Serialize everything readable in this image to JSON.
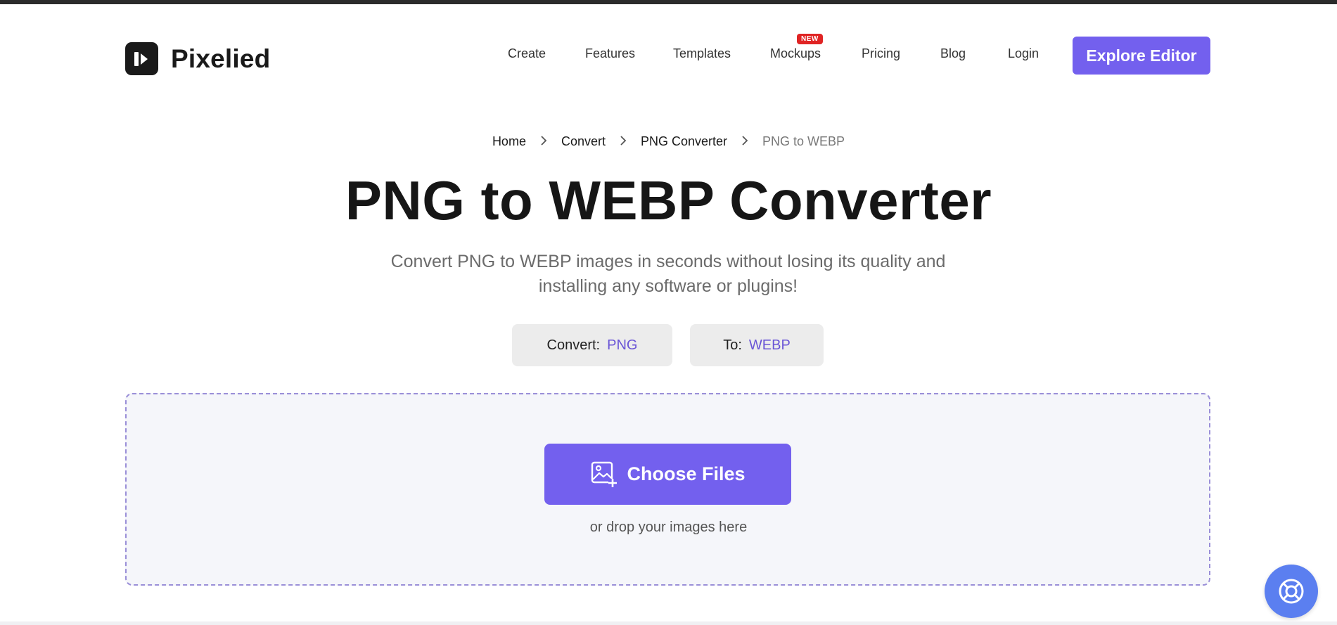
{
  "brand": {
    "name": "Pixelied"
  },
  "nav": {
    "items": [
      "Create",
      "Features",
      "Templates",
      "Mockups",
      "Pricing",
      "Blog",
      "Login"
    ],
    "new_badge": "NEW",
    "cta_label": "Explore Editor"
  },
  "breadcrumb": [
    "Home",
    "Convert",
    "PNG Converter",
    "PNG to WEBP"
  ],
  "hero": {
    "title": "PNG to WEBP Converter",
    "subtitle": "Convert PNG to WEBP images in seconds without losing its quality and installing any software or plugins!"
  },
  "format": {
    "from_label": "Convert:",
    "from_value": "PNG",
    "to_label": "To:",
    "to_value": "WEBP"
  },
  "upload": {
    "button_label": "Choose Files",
    "hint": "or drop your images here"
  },
  "icons": {
    "logo": "pixelied-logo-icon",
    "chevron": "chevron-right-icon",
    "upload": "add-image-icon",
    "help": "lifebuoy-icon"
  },
  "colors": {
    "accent": "#7360ee",
    "accent_text": "#6a55d6",
    "badge": "#e02424",
    "help": "#5b7ff0"
  }
}
